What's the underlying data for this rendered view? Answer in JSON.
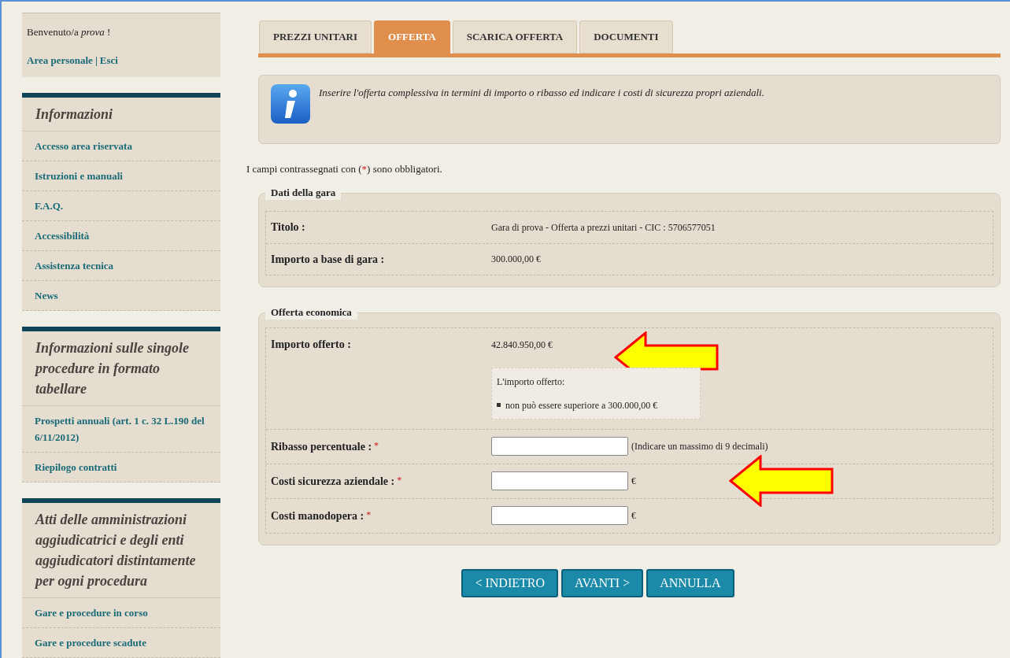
{
  "sidebar": {
    "welcome": "Benvenuto/a *prova* !",
    "user_links": [
      {
        "label": "Area personale"
      },
      {
        "label": "Esci"
      }
    ],
    "separator": "|",
    "sections": [
      {
        "title": "Informazioni",
        "items": [
          {
            "label": "Accesso area riservata"
          },
          {
            "label": "Istruzioni e manuali"
          },
          {
            "label": "F.A.Q."
          },
          {
            "label": "Accessibilità"
          },
          {
            "label": "Assistenza tecnica"
          },
          {
            "label": "News"
          }
        ]
      },
      {
        "title": "Informazioni sulle singole procedure in formato tabellare",
        "items": [
          {
            "label": "Prospetti annuali (art. 1 c. 32 L.190 del 6/11/2012)"
          },
          {
            "label": "Riepilogo contratti"
          }
        ]
      },
      {
        "title": "Atti delle amministrazioni aggiudicatrici e degli enti aggiudicatori distintamente per ogni procedura",
        "items": [
          {
            "label": "Gare e procedure in corso"
          },
          {
            "label": "Gare e procedure scadute"
          }
        ]
      }
    ]
  },
  "tabs": [
    {
      "label": "PREZZI UNITARI",
      "selected": false
    },
    {
      "label": "OFFERTA",
      "selected": true
    },
    {
      "label": "SCARICA OFFERTA",
      "selected": false
    },
    {
      "label": "DOCUMENTI",
      "selected": false
    }
  ],
  "info_message": "Inserire l'offerta complessiva in termini di importo o ribasso ed indicare i costi di sicurezza propri aziendali.",
  "required_note": {
    "before": "I campi contrassegnati con (",
    "mark": "*",
    "after": ") sono obbligatori."
  },
  "gara": {
    "legend": "Dati della gara",
    "rows": [
      {
        "label": "Titolo :",
        "value": "Gara di prova - Offerta a prezzi unitari - CIC : 5706577051"
      },
      {
        "label": "Importo a base di gara :",
        "value": "300.000,00 €"
      }
    ]
  },
  "offerta": {
    "legend": "Offerta economica",
    "importo": {
      "label": "Importo offerto :",
      "value": "42.840.950,00 €",
      "note_title": "L'importo offerto:",
      "note_items": [
        "non può essere superiore a 300.000,00 €"
      ]
    },
    "fields": [
      {
        "label": "Ribasso percentuale :",
        "required": "*",
        "suffix": "(Indicare un massimo di 9 decimali)"
      },
      {
        "label": "Costi sicurezza aziendale :",
        "required": "*",
        "suffix": "€"
      },
      {
        "label": "Costi manodopera :",
        "required": "*",
        "suffix": "€"
      }
    ]
  },
  "buttons": [
    {
      "label": "< INDIETRO"
    },
    {
      "label": "AVANTI >"
    },
    {
      "label": "ANNULLA"
    }
  ]
}
